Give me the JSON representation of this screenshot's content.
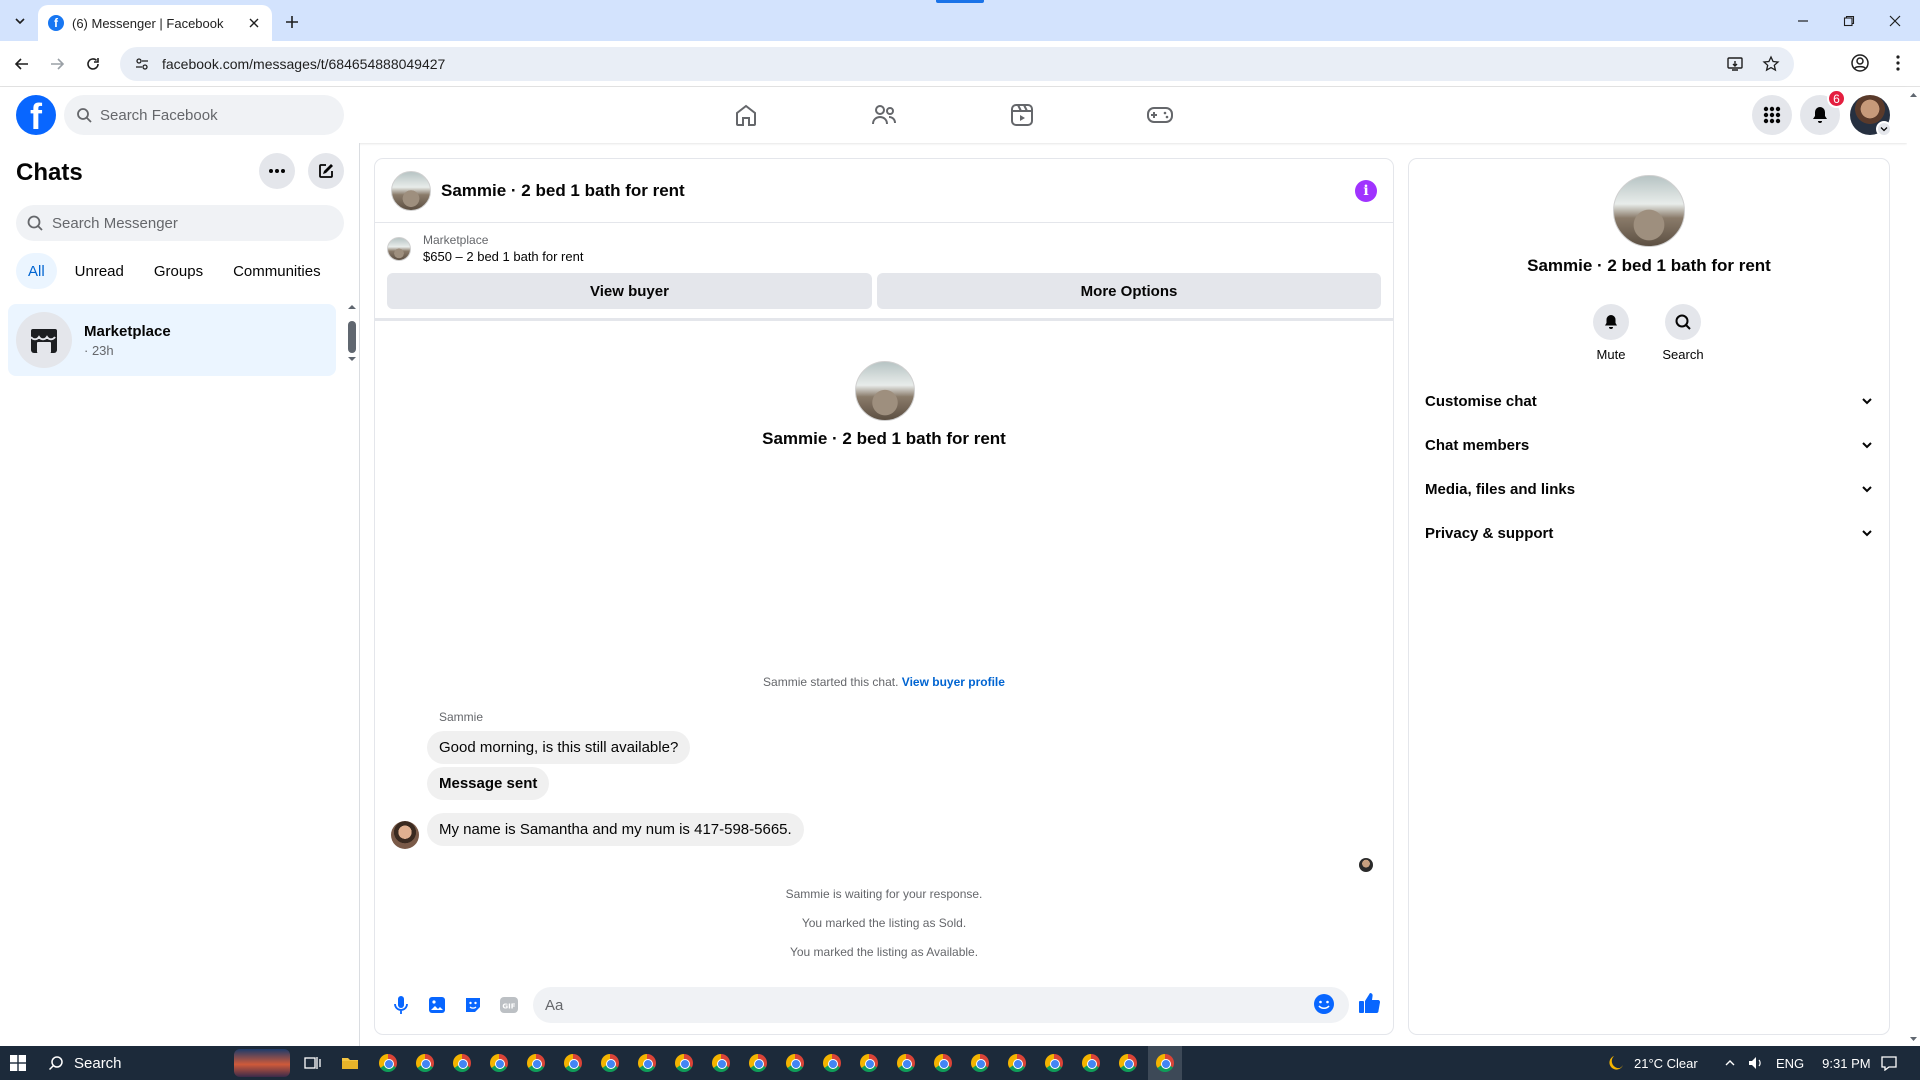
{
  "browser": {
    "tab_title": "(6) Messenger | Facebook",
    "url": "facebook.com/messages/t/684654888049427"
  },
  "header": {
    "search_placeholder": "Search Facebook",
    "notification_count": "6"
  },
  "sidebar": {
    "title": "Chats",
    "search_placeholder": "Search Messenger",
    "filters": [
      "All",
      "Unread",
      "Groups",
      "Communities"
    ],
    "active_filter": "All",
    "chats": [
      {
        "name": "Marketplace",
        "time": "· 23h"
      }
    ]
  },
  "conversation": {
    "title": "Sammie · 2 bed 1 bath for rent",
    "listing": {
      "category": "Marketplace",
      "price_title": "$650 – 2 bed 1 bath for rent",
      "view_buyer": "View buyer",
      "more_options": "More Options"
    },
    "center_name": "Sammie · 2 bed 1 bath for rent",
    "started_text": "Sammie started this chat.",
    "started_link": "View buyer profile",
    "sender": "Sammie",
    "messages": [
      {
        "text": "Good morning, is this still available?",
        "bold": false
      },
      {
        "text": "Message sent",
        "bold": true
      },
      {
        "text": "My name is Samantha and my num is 417-598-5665.",
        "bold": false
      }
    ],
    "system_lines": [
      "Sammie is waiting for your response.",
      "You marked the listing as Sold.",
      "You marked the listing as Available."
    ],
    "composer_placeholder": "Aa"
  },
  "details": {
    "name": "Sammie · 2 bed 1 bath for rent",
    "actions": [
      "Mute",
      "Search"
    ],
    "sections": [
      "Customise chat",
      "Chat members",
      "Media, files and links",
      "Privacy & support"
    ]
  },
  "taskbar": {
    "search_label": "Search",
    "weather": "21°C  Clear",
    "language": "ENG",
    "time": "9:31 PM"
  },
  "colors": {
    "fb_blue": "#0866ff",
    "accent_link": "#0064d1",
    "info_purple": "#a033ff",
    "badge_red": "#e41e3f"
  }
}
